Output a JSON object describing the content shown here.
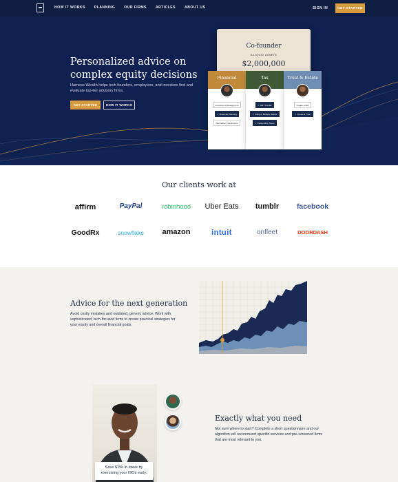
{
  "nav": {
    "links": [
      "HOW IT WORKS",
      "PLANNING",
      "OUR FIRMS",
      "ARTICLES",
      "ABOUT US"
    ],
    "sign_in": "SIGN IN",
    "get_started": "GET STARTED"
  },
  "hero": {
    "title": "Personalized advice on complex equity decisions",
    "subtitle": "Harness Wealth helps tech founders, employees, and investors find and evaluate top-tier advisory firms.",
    "primary_button": "GET STARTED",
    "secondary_button": "HOW IT WORKS",
    "card": {
      "title": "Co-founder",
      "label": "ILLIQUID ASSETS",
      "value": "$2,000,000",
      "columns": [
        {
          "title": "Financial",
          "color": "#c08a3a",
          "items": [
            {
              "text": "Investment Management",
              "dark": false
            },
            {
              "text": "Financial Planning",
              "dark": true
            },
            {
              "text": "Alternative Investments",
              "dark": false
            }
          ]
        },
        {
          "title": "Tax",
          "color": "#3f5a34",
          "items": [
            {
              "text": "AMT Credits",
              "dark": true
            },
            {
              "text": "Filing in Multiple States",
              "dark": true
            },
            {
              "text": "Partnership Taxes",
              "dark": true
            }
          ]
        },
        {
          "title": "Trust & Estate",
          "color": "#6e8fb3",
          "items": [
            {
              "text": "Create a Will",
              "dark": false
            },
            {
              "text": "Create a Trust",
              "dark": true
            }
          ]
        }
      ]
    }
  },
  "clients": {
    "title": "Our clients work at",
    "logos": [
      {
        "name": "affirm",
        "color": "#111"
      },
      {
        "name": "PayPal",
        "color": "#1f3f8f"
      },
      {
        "name": "robinhood",
        "color": "#21c25e"
      },
      {
        "name": "Uber Eats",
        "color": "#111"
      },
      {
        "name": "tumblr",
        "color": "#111"
      },
      {
        "name": "facebook",
        "color": "#3b5998"
      },
      {
        "name": "GoodRx",
        "color": "#111"
      },
      {
        "name": "snowflake",
        "color": "#29b5e8"
      },
      {
        "name": "amazon",
        "color": "#111"
      },
      {
        "name": "intuit",
        "color": "#236cff"
      },
      {
        "name": "onfleet",
        "color": "#5a6a8a"
      },
      {
        "name": "DOORDASH",
        "color": "#ff3008"
      }
    ]
  },
  "advice": {
    "title": "Advice for the next generation",
    "body": "Avoid costly mistakes and outdated, generic advice. Work with sophisticated, tech-focused firms to create practical strategies for your equity and overall financial goals."
  },
  "exactly": {
    "title": "Exactly what you need",
    "body": "Not sure where to start? Complete a short questionnaire and our algorithm will recommend specific services and pre-screened firms that are most relevant to you.",
    "caption_line1": "Save $15k in taxes by",
    "caption_line2": "exercising your ISOs early."
  }
}
